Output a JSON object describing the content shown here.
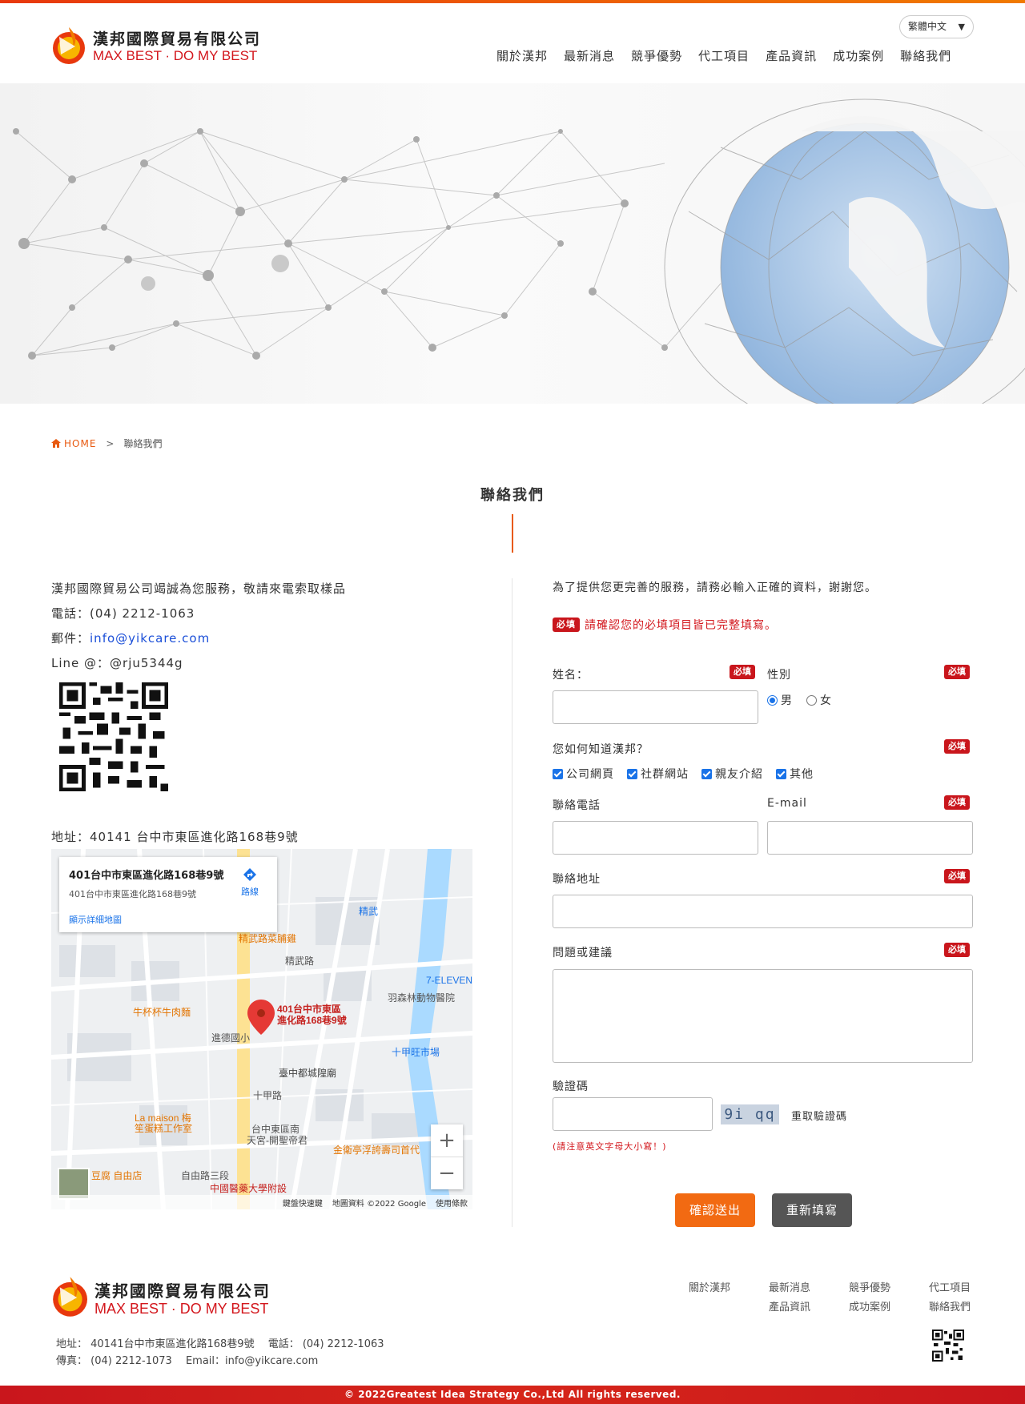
{
  "header": {
    "logo_cn": "漢邦國際貿易有限公司",
    "logo_en": "MAX BEST · DO MY BEST",
    "language": "繁體中文",
    "nav": [
      "關於漢邦",
      "最新消息",
      "競爭優勢",
      "代工項目",
      "產品資訊",
      "成功案例",
      "聯絡我們"
    ]
  },
  "breadcrumb": {
    "home": "HOME",
    "separator": ">",
    "current": "聯絡我們"
  },
  "page_title": "聯絡我們",
  "contact": {
    "intro": "漢邦國際貿易公司竭誠為您服務，敬請來電索取樣品",
    "phone": "電話：(04) 2212-1063",
    "email_label": "郵件：",
    "email": "info@yikcare.com",
    "line": "Line @：@rju5344g",
    "address": "地址：40141 台中市東區進化路168巷9號"
  },
  "map": {
    "card_title": "401台中市東區進化路168巷9號",
    "card_sub": "401台中市東區進化路168巷9號",
    "card_link": "顯示詳細地圖",
    "route": "路線",
    "pin_label_1": "401台中市東區",
    "pin_label_2": "進化路168巷9號",
    "labels": [
      "精武路菜脯雞",
      "精武路",
      "精武",
      "牛杯杯牛肉麵",
      "進德國小",
      "臺中都城隍廟",
      "十甲旺市場",
      "羽森林動物醫院",
      "La maison 梅",
      "笙蛋糕工作室",
      "台中東區南",
      "天宮-開聖帝君",
      "金衛亭浮誇壽司首代",
      "豆腐 自由店",
      "中國醫藥大學附設",
      "7-ELEVEN",
      "十甲路",
      "自由路三段"
    ],
    "zoom_in": "+",
    "zoom_out": "−",
    "footer": [
      "鍵盤快速鍵",
      "地圖資料 ©2022 Google",
      "使用條款"
    ]
  },
  "form": {
    "lead": "為了提供您更完善的服務，請務必輸入正確的資料，謝謝您。",
    "required_badge": "必填",
    "required_note": "請確認您的必填項目皆已完整填寫。",
    "name_label": "姓名：",
    "gender_label": "性別",
    "gender_options": [
      "男",
      "女"
    ],
    "gender_selected": "男",
    "source_label": "您如何知道漢邦？",
    "source_options": [
      "公司網頁",
      "社群網站",
      "親友介紹",
      "其他"
    ],
    "phone_label": "聯絡電話",
    "email_label": "E-mail",
    "address_label": "聯絡地址",
    "question_label": "問題或建議",
    "captcha_label": "驗證碼",
    "captcha_text": "9i qq",
    "captcha_refresh": "重取驗證碼",
    "captcha_hint": "(請注意英文字母大小寫！)",
    "submit": "確認送出",
    "reset": "重新填寫"
  },
  "footer": {
    "logo_cn": "漢邦國際貿易有限公司",
    "logo_en": "MAX BEST · DO MY BEST",
    "nav": [
      "關於漢邦",
      "最新消息",
      "競爭優勢",
      "代工項目",
      "產品資訊",
      "成功案例",
      "聯絡我們"
    ],
    "address_line": "地址： 40141台中市東區進化路168巷9號　 電話： (04) 2212-1063",
    "fax_line": "傳真： (04) 2212-1073　 Email：info@yikcare.com",
    "copyright": "© 2022Greatest Idea Strategy Co.,Ltd All rights reserved."
  },
  "colors": {
    "accent": "#e85a11",
    "brand_red": "#c9161c",
    "link": "#1b4fd8"
  }
}
